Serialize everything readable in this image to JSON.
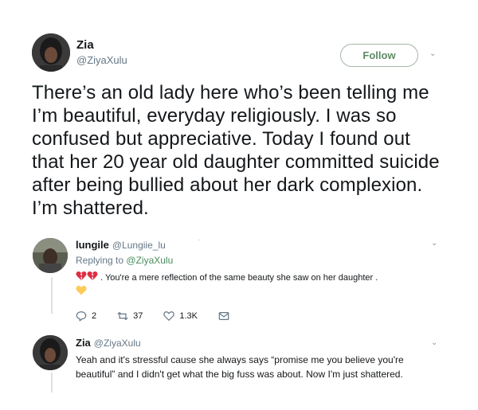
{
  "tweet": {
    "author_name": "Zia",
    "author_handle": "@ZiyaXulu",
    "follow_label": "Follow",
    "text": "There’s an old lady here who’s been telling me I’m beautiful, everyday religiously. I was so confused but appreciative. Today I found out that her 20 year old daughter committed suicide after being bullied about her dark complexion. I’m shattered."
  },
  "replies": [
    {
      "author_name": "lungile",
      "author_handle": "@Lungiie_lu",
      "replying_prefix": "Replying to",
      "replying_to": "@ZiyaXulu",
      "text": ". You're a mere reflection of the same beauty she saw on her daughter .",
      "actions": {
        "reply_count": "2",
        "retweet_count": "37",
        "like_count": "1.3K"
      }
    },
    {
      "author_name": "Zia",
      "author_handle": "@ZiyaXulu",
      "text": "Yeah and it's stressful cause she always says “promise me you believe you're beautiful” and I didn't get what the big fuss was about. Now I'm just shattered."
    }
  ],
  "icons": {
    "broken_heart": "broken-heart-emoji",
    "yellow_heart": "yellow-heart-emoji",
    "reply": "reply-icon",
    "retweet": "retweet-icon",
    "like": "heart-icon",
    "dm": "envelope-icon",
    "more": "chevron-down-icon"
  },
  "colors": {
    "accent": "#4a8c5c",
    "follow_border": "#a3b8a6",
    "muted": "#657786",
    "thread_line": "#d9e4d9"
  }
}
